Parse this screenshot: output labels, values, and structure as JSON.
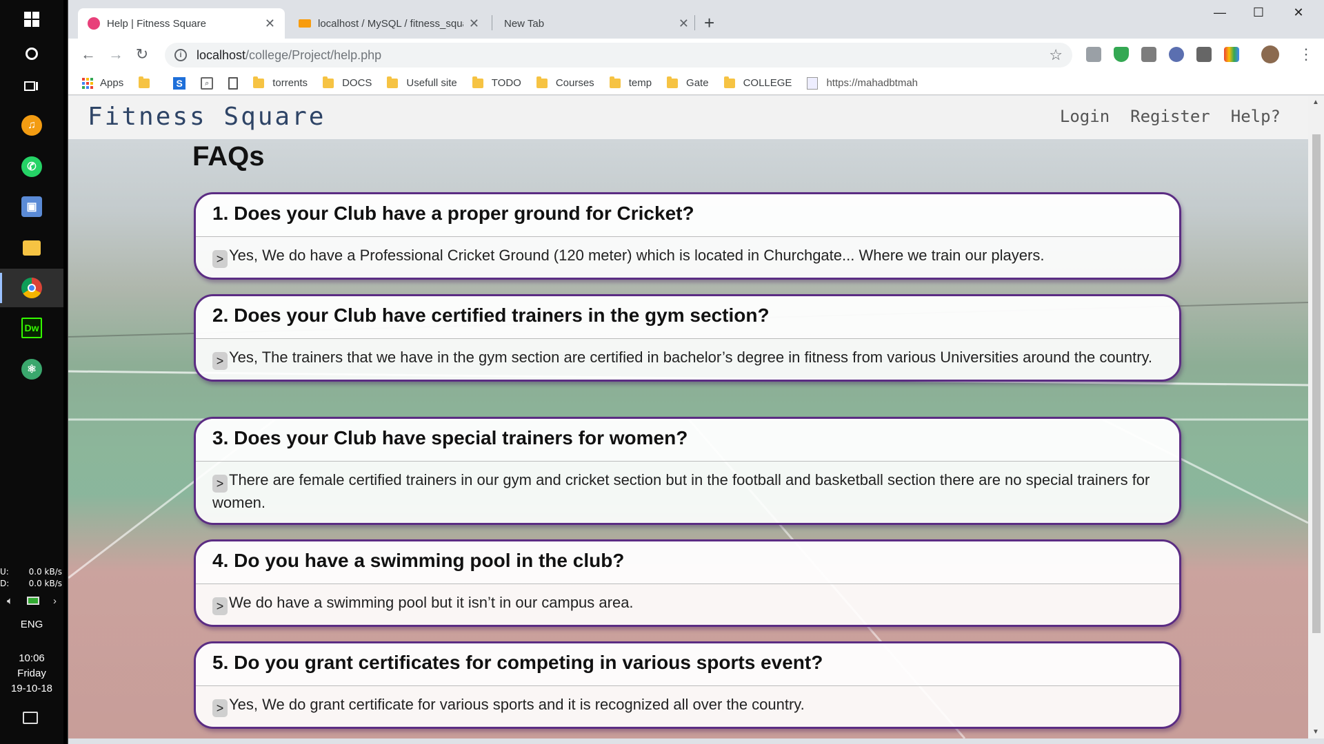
{
  "taskbar": {
    "network": {
      "upload_label": "U:",
      "upload_value": "0.0 kB/s",
      "download_label": "D:",
      "download_value": "0.0 kB/s"
    },
    "language": "ENG",
    "clock": {
      "time": "10:06",
      "day": "Friday",
      "date": "19-10-18"
    },
    "apps": [
      "windows-start-icon",
      "cortana-icon",
      "task-view-icon",
      "music-app-icon",
      "whatsapp-icon",
      "3d-box-app-icon",
      "file-explorer-icon",
      "chrome-icon",
      "dreamweaver-icon",
      "atom-icon"
    ]
  },
  "browser": {
    "tabs": [
      {
        "title": "Help | Fitness Square",
        "active": true
      },
      {
        "title": "localhost / MySQL / fitness_squa",
        "active": false
      },
      {
        "title": "New Tab",
        "active": false
      }
    ],
    "url": {
      "host": "localhost",
      "path": "/college/Project/help.php"
    },
    "bookmarks": {
      "apps": "Apps",
      "items": [
        "torrents",
        "DOCS",
        "Usefull site",
        "TODO",
        "Courses",
        "temp",
        "Gate",
        "COLLEGE",
        "https://mahadbtmah"
      ]
    }
  },
  "site": {
    "logo": "Fitness Square",
    "nav": {
      "login": "Login",
      "register": "Register",
      "help": "Help?"
    },
    "faq_heading": "FAQs",
    "faqs": [
      {
        "q": "1. Does your Club have a proper ground for Cricket?",
        "a": "Yes, We do have a Professional Cricket Ground (120 meter) which is located in Churchgate... Where we train our players."
      },
      {
        "q": "2. Does your Club have certified trainers in the gym section?",
        "a": "Yes, The trainers that we have in the gym section are certified in bachelor’s degree in fitness from various Universities around the country."
      },
      {
        "q": "3. Does your Club have special trainers for women?",
        "a": "There are female certified trainers in our gym and cricket section but in the football and basketball section there are no special trainers for women."
      },
      {
        "q": "4. Do you have a swimming pool in the club?",
        "a": "We do have a swimming pool but it isn’t in our campus area."
      },
      {
        "q": "5. Do you grant certificates for competing in various sports event?",
        "a": "Yes, We do grant certificate for various sports and it is recognized all over the country."
      }
    ],
    "chevron": ">"
  },
  "colors": {
    "faq_border": "#5b2c83",
    "logo": "#2e4466"
  }
}
